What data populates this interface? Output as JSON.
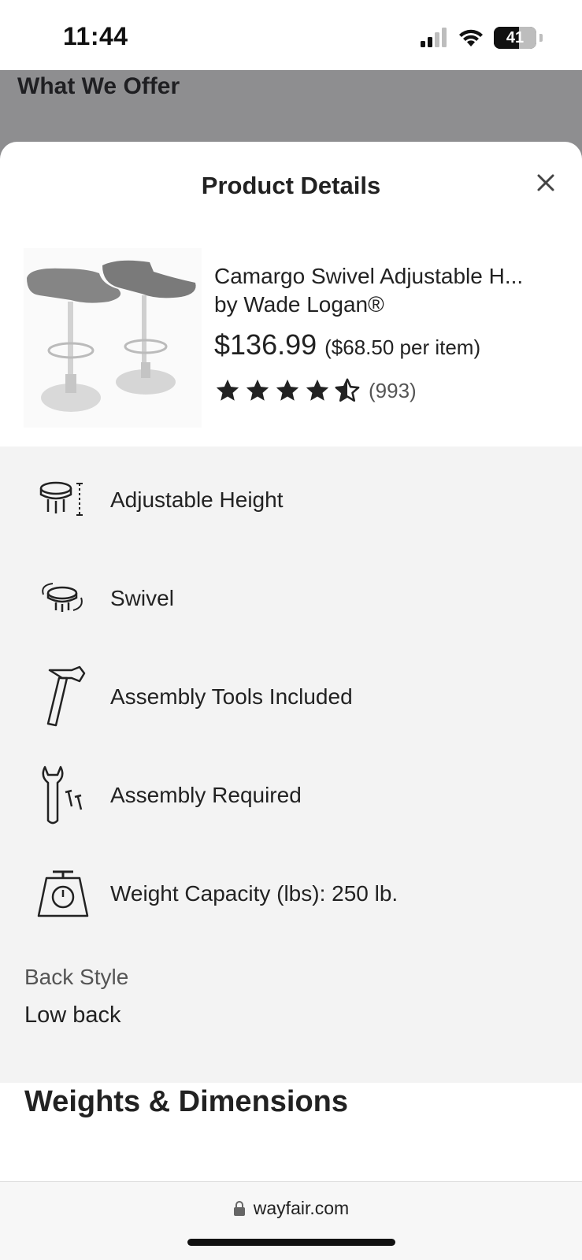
{
  "status_bar": {
    "time": "11:44",
    "battery": "41"
  },
  "backdrop": {
    "title": "What We Offer"
  },
  "sheet": {
    "title": "Product Details",
    "product": {
      "name": "Camargo Swivel Adjustable H...",
      "brand": "by Wade Logan®",
      "price": "$136.99",
      "per_item": "($68.50 per item)",
      "rating": 4.5,
      "review_count": "(993)"
    },
    "features": [
      {
        "icon": "adjustable-height-icon",
        "label": "Adjustable Height"
      },
      {
        "icon": "swivel-icon",
        "label": "Swivel"
      },
      {
        "icon": "hammer-icon",
        "label": "Assembly Tools Included"
      },
      {
        "icon": "wrench-icon",
        "label": "Assembly Required"
      },
      {
        "icon": "scale-icon",
        "label": "Weight Capacity (lbs): 250 lb."
      }
    ],
    "back_style": {
      "label": "Back Style",
      "value": "Low back"
    },
    "weights_heading": "Weights & Dimensions"
  },
  "url_bar": {
    "url": "wayfair.com"
  }
}
